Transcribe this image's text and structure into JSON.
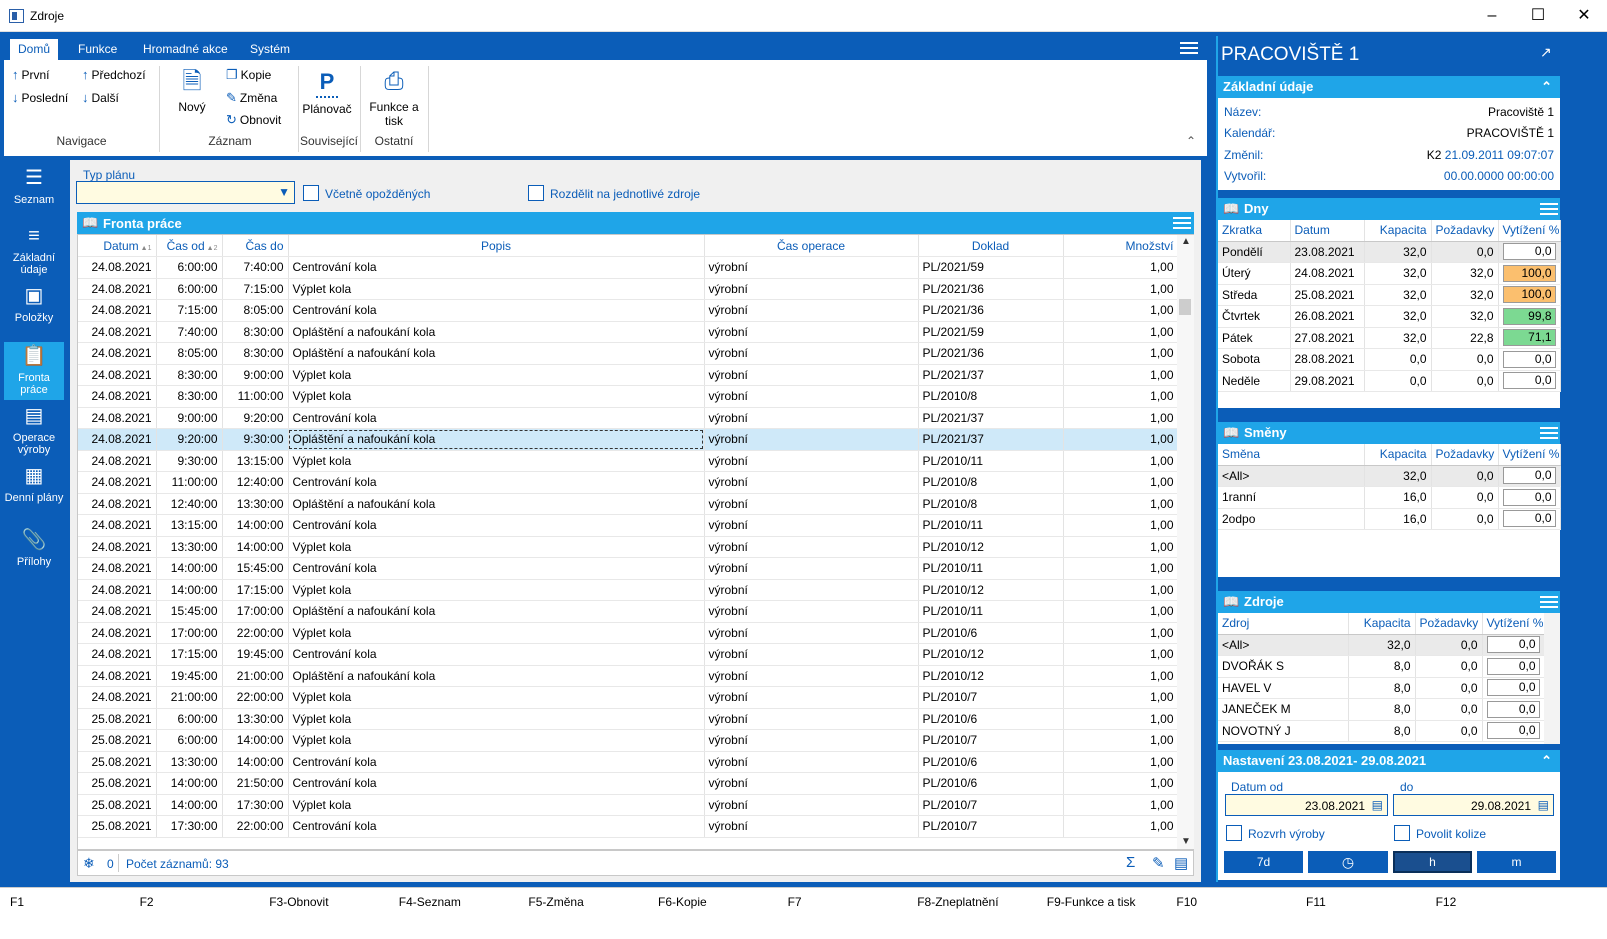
{
  "window": {
    "title": "Zdroje"
  },
  "tabs": [
    {
      "label": "Domů"
    },
    {
      "label": "Funkce"
    },
    {
      "label": "Hromadné akce"
    },
    {
      "label": "Systém"
    }
  ],
  "ribbon": {
    "nav": {
      "first": "První",
      "prev": "Předchozí",
      "last": "Poslední",
      "next": "Další",
      "group": "Navigace"
    },
    "record": {
      "new": "Nový",
      "copy": "Kopie",
      "change": "Změna",
      "refresh": "Obnovit",
      "group": "Záznam"
    },
    "related": {
      "planner_icon": "P",
      "planner": "Plánovač",
      "group": "Související"
    },
    "other": {
      "print": "Funkce a tisk",
      "group": "Ostatní"
    }
  },
  "sidenav": [
    {
      "label": "Seznam",
      "icon": "list-icon"
    },
    {
      "label": "Základní údaje",
      "icon": "details-icon"
    },
    {
      "label": "Položky",
      "icon": "box-icon"
    },
    {
      "label": "Fronta práce",
      "icon": "clipboard-icon"
    },
    {
      "label": "Operace výroby",
      "icon": "operation-icon"
    },
    {
      "label": "Denní plány",
      "icon": "plan-icon"
    },
    {
      "label": "Přílohy",
      "icon": "paperclip-icon"
    }
  ],
  "filters": {
    "plan_type_label": "Typ plánu",
    "plan_type_value": "",
    "include_late": "Včetně opožděných",
    "split_resources": "Rozdělit na jednotlivé zdroje"
  },
  "grid": {
    "title": "Fronta práce",
    "columns": [
      "Datum",
      "Čas od",
      "Čas do",
      "Popis",
      "Čas operace",
      "Doklad",
      "Množství"
    ],
    "rows": [
      [
        "24.08.2021",
        "6:00:00",
        "7:40:00",
        "Centrování kola",
        "výrobní",
        "PL/2021/59",
        "1,00"
      ],
      [
        "24.08.2021",
        "6:00:00",
        "7:15:00",
        "Výplet kola",
        "výrobní",
        "PL/2021/36",
        "1,00"
      ],
      [
        "24.08.2021",
        "7:15:00",
        "8:05:00",
        "Centrování kola",
        "výrobní",
        "PL/2021/36",
        "1,00"
      ],
      [
        "24.08.2021",
        "7:40:00",
        "8:30:00",
        "Opláštění a nafoukání kola",
        "výrobní",
        "PL/2021/59",
        "1,00"
      ],
      [
        "24.08.2021",
        "8:05:00",
        "8:30:00",
        "Opláštění a nafoukání kola",
        "výrobní",
        "PL/2021/36",
        "1,00"
      ],
      [
        "24.08.2021",
        "8:30:00",
        "9:00:00",
        "Výplet kola",
        "výrobní",
        "PL/2021/37",
        "1,00"
      ],
      [
        "24.08.2021",
        "8:30:00",
        "11:00:00",
        "Výplet kola",
        "výrobní",
        "PL/2010/8",
        "1,00"
      ],
      [
        "24.08.2021",
        "9:00:00",
        "9:20:00",
        "Centrování kola",
        "výrobní",
        "PL/2021/37",
        "1,00"
      ],
      [
        "24.08.2021",
        "9:20:00",
        "9:30:00",
        "Opláštění a nafoukání kola",
        "výrobní",
        "PL/2021/37",
        "1,00"
      ],
      [
        "24.08.2021",
        "9:30:00",
        "13:15:00",
        "Výplet kola",
        "výrobní",
        "PL/2010/11",
        "1,00"
      ],
      [
        "24.08.2021",
        "11:00:00",
        "12:40:00",
        "Centrování kola",
        "výrobní",
        "PL/2010/8",
        "1,00"
      ],
      [
        "24.08.2021",
        "12:40:00",
        "13:30:00",
        "Opláštění a nafoukání kola",
        "výrobní",
        "PL/2010/8",
        "1,00"
      ],
      [
        "24.08.2021",
        "13:15:00",
        "14:00:00",
        "Centrování kola",
        "výrobní",
        "PL/2010/11",
        "1,00"
      ],
      [
        "24.08.2021",
        "13:30:00",
        "14:00:00",
        "Výplet kola",
        "výrobní",
        "PL/2010/12",
        "1,00"
      ],
      [
        "24.08.2021",
        "14:00:00",
        "15:45:00",
        "Centrování kola",
        "výrobní",
        "PL/2010/11",
        "1,00"
      ],
      [
        "24.08.2021",
        "14:00:00",
        "17:15:00",
        "Výplet kola",
        "výrobní",
        "PL/2010/12",
        "1,00"
      ],
      [
        "24.08.2021",
        "15:45:00",
        "17:00:00",
        "Opláštění a nafoukání kola",
        "výrobní",
        "PL/2010/11",
        "1,00"
      ],
      [
        "24.08.2021",
        "17:00:00",
        "22:00:00",
        "Výplet kola",
        "výrobní",
        "PL/2010/6",
        "1,00"
      ],
      [
        "24.08.2021",
        "17:15:00",
        "19:45:00",
        "Centrování kola",
        "výrobní",
        "PL/2010/12",
        "1,00"
      ],
      [
        "24.08.2021",
        "19:45:00",
        "21:00:00",
        "Opláštění a nafoukání kola",
        "výrobní",
        "PL/2010/12",
        "1,00"
      ],
      [
        "24.08.2021",
        "21:00:00",
        "22:00:00",
        "Výplet kola",
        "výrobní",
        "PL/2010/7",
        "1,00"
      ],
      [
        "25.08.2021",
        "6:00:00",
        "13:30:00",
        "Výplet kola",
        "výrobní",
        "PL/2010/6",
        "1,00"
      ],
      [
        "25.08.2021",
        "6:00:00",
        "14:00:00",
        "Výplet kola",
        "výrobní",
        "PL/2010/7",
        "1,00"
      ],
      [
        "25.08.2021",
        "13:30:00",
        "14:00:00",
        "Centrování kola",
        "výrobní",
        "PL/2010/6",
        "1,00"
      ],
      [
        "25.08.2021",
        "14:00:00",
        "21:50:00",
        "Centrování kola",
        "výrobní",
        "PL/2010/6",
        "1,00"
      ],
      [
        "25.08.2021",
        "14:00:00",
        "17:30:00",
        "Výplet kola",
        "výrobní",
        "PL/2010/7",
        "1,00"
      ],
      [
        "25.08.2021",
        "17:30:00",
        "22:00:00",
        "Centrování kola",
        "výrobní",
        "PL/2010/7",
        "1,00"
      ]
    ],
    "selected_row": 8,
    "sort_index_1": "1",
    "sort_index_2": "2",
    "footer_count": "0",
    "footer_records": "Počet záznamů: 93"
  },
  "fkeys": [
    "F1",
    "F2",
    "F3-Obnovit",
    "F4-Seznam",
    "F5-Změna",
    "F6-Kopie",
    "F7",
    "F8-Zneplatnění",
    "F9-Funkce a tisk",
    "F10",
    "F11",
    "F12"
  ],
  "right": {
    "title": "PRACOVIŠTĚ 1",
    "basic": {
      "title": "Základní údaje",
      "name_label": "Název:",
      "name": "Pracoviště 1",
      "calendar_label": "Kalendář:",
      "calendar": "PRACOVIŠTĚ 1",
      "changed_label": "Změnil:",
      "changed_user": "K2",
      "changed_date": "21.09.2011 09:07:07",
      "created_label": "Vytvořil:",
      "created_date": "00.00.0000 00:00:00"
    },
    "days": {
      "title": "Dny",
      "columns": [
        "Zkratka",
        "Datum",
        "Kapacita",
        "Požadavky",
        "Vytížení %"
      ],
      "rows": [
        [
          "Pondělí",
          "23.08.2021",
          "32,0",
          "0,0",
          "0,0"
        ],
        [
          "Úterý",
          "24.08.2021",
          "32,0",
          "32,0",
          "100,0"
        ],
        [
          "Středa",
          "25.08.2021",
          "32,0",
          "32,0",
          "100,0"
        ],
        [
          "Čtvrtek",
          "26.08.2021",
          "32,0",
          "32,0",
          "99,8"
        ],
        [
          "Pátek",
          "27.08.2021",
          "32,0",
          "22,8",
          "71,1"
        ],
        [
          "Sobota",
          "28.08.2021",
          "0,0",
          "0,0",
          "0,0"
        ],
        [
          "Neděle",
          "29.08.2021",
          "0,0",
          "0,0",
          "0,0"
        ]
      ],
      "highlight": [
        "",
        "orange",
        "orange",
        "green",
        "green",
        "",
        ""
      ]
    },
    "shifts": {
      "title": "Směny",
      "columns": [
        "Směna",
        "Kapacita",
        "Požadavky",
        "Vytížení %"
      ],
      "rows": [
        [
          "<All>",
          "32,0",
          "0,0",
          "0,0"
        ],
        [
          "1ranní",
          "16,0",
          "0,0",
          "0,0"
        ],
        [
          "2odpo",
          "16,0",
          "0,0",
          "0,0"
        ]
      ]
    },
    "resources": {
      "title": "Zdroje",
      "columns": [
        "Zdroj",
        "Kapacita",
        "Požadavky",
        "Vytížení %"
      ],
      "rows": [
        [
          "<All>",
          "32,0",
          "0,0",
          "0,0"
        ],
        [
          "DVOŘÁK S",
          "8,0",
          "0,0",
          "0,0"
        ],
        [
          "HAVEL V",
          "8,0",
          "0,0",
          "0,0"
        ],
        [
          "JANEČEK M",
          "8,0",
          "0,0",
          "0,0"
        ],
        [
          "NOVOTNÝ J",
          "8,0",
          "0,0",
          "0,0"
        ]
      ]
    },
    "settings": {
      "title": "Nastavení 23.08.2021- 29.08.2021",
      "from_label": "Datum od",
      "from": "23.08.2021",
      "to_label": "do",
      "to": "29.08.2021",
      "schedule": "Rozvrh výroby",
      "collisions": "Povolit kolize",
      "btn_7d": "7d",
      "btn_h": "h",
      "btn_m": "m"
    }
  }
}
